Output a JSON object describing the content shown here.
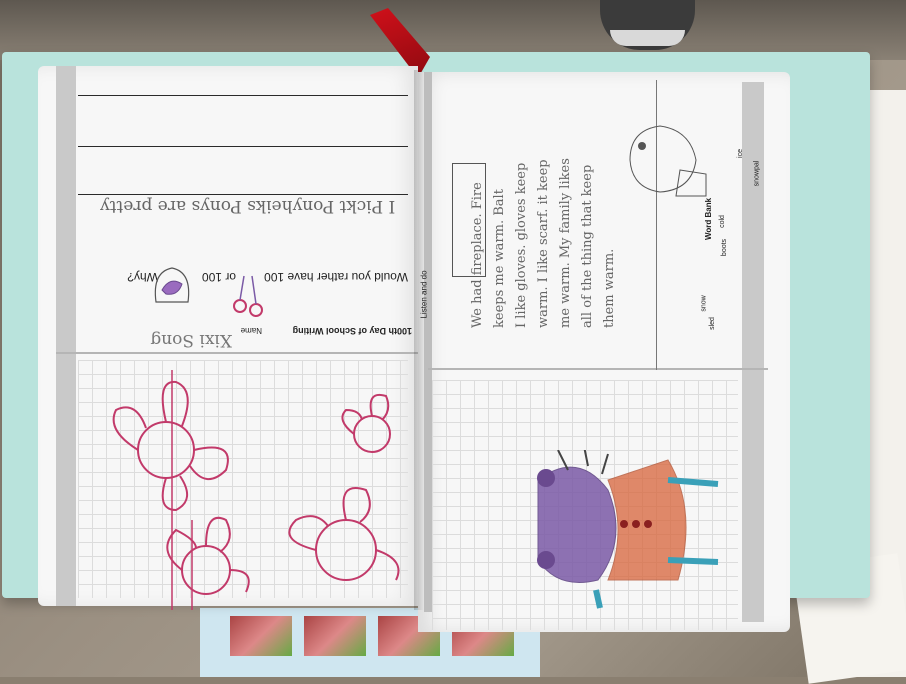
{
  "left_page": {
    "top_section": {
      "header": "100th Day of School Writing",
      "name_label": "Name",
      "name_value": "Xixi Song",
      "prompt_part1": "Would you rather have 100",
      "prompt_part2": "or 100",
      "prompt_part3": "Why?",
      "answer": "I Pickt Ponyheiks Ponys are pretty"
    }
  },
  "right_page": {
    "top_section": {
      "label": "Listen and do",
      "story_lines": [
        "We had fireplace. Fire",
        "keeps me warm. Balt",
        "I like gloves. gloves keep",
        "warm. I like scarf. it keep",
        "me warm. My family likes",
        "all of the thing that keep",
        "them warm."
      ],
      "word_bank_title": "Word Bank",
      "word_bank": [
        "cold",
        "boots",
        "ice",
        "snowpal",
        "snow",
        "sled"
      ]
    }
  },
  "colors": {
    "cover": "#b9e3dc",
    "page": "#f7f7f7",
    "pink_drawing": "#c23a6a",
    "purple": "#7b5aa6",
    "orange": "#d8643a",
    "teal": "#3aa0b8",
    "ribbon": "#d0101a"
  }
}
